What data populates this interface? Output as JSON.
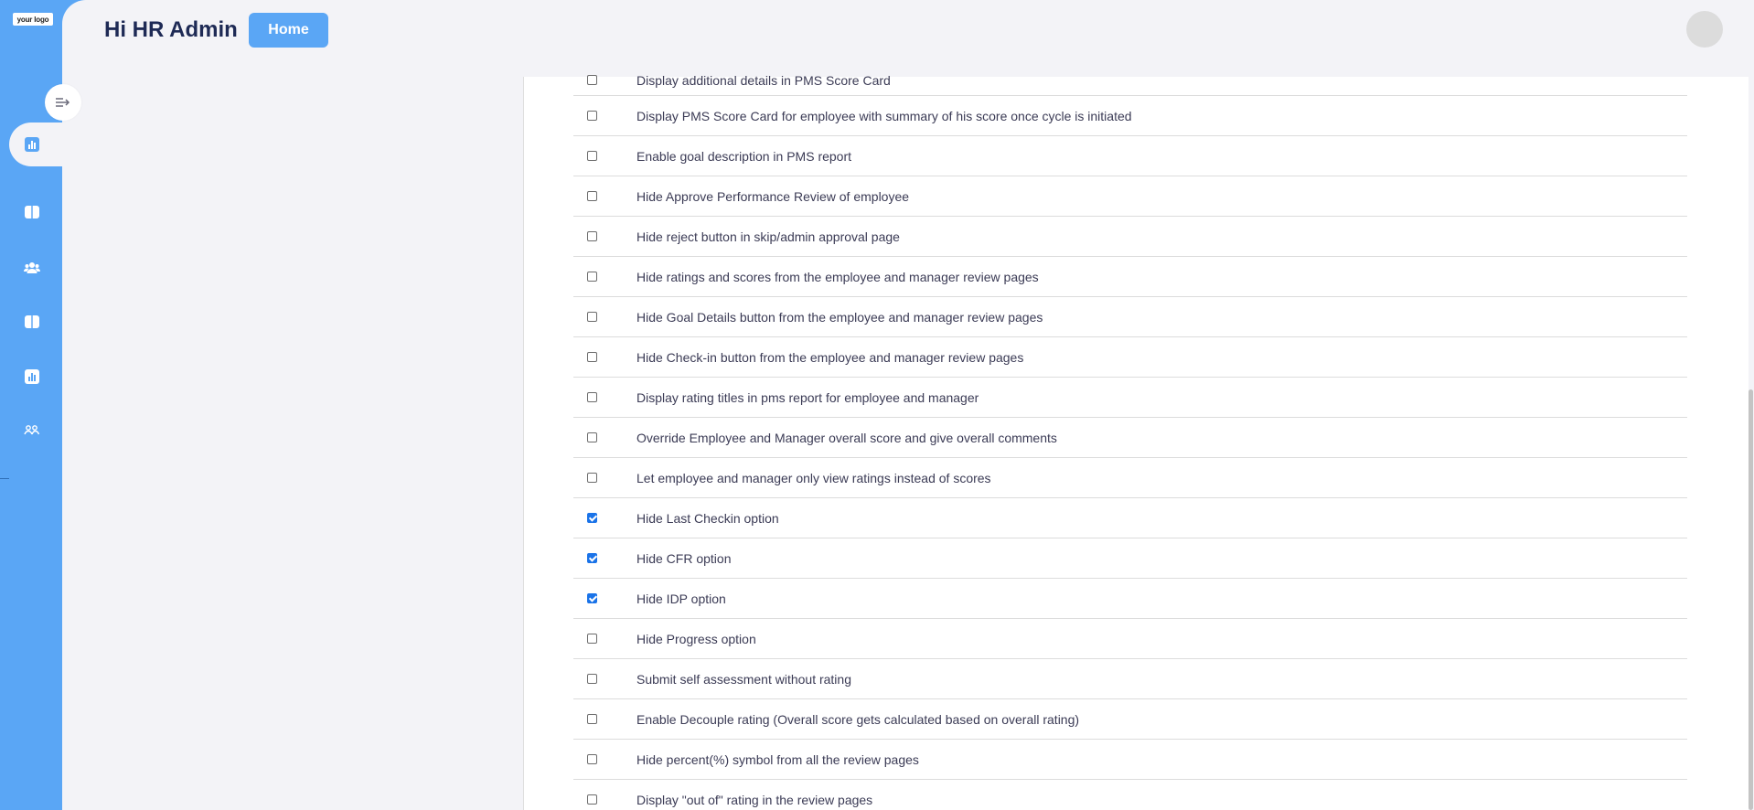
{
  "app": {
    "logo_text": "your logo",
    "greeting": "Hi HR Admin",
    "home_label": "Home",
    "accent_color": "#5aa6f5",
    "checkbox_checked_color": "#1a73e8"
  },
  "sidebar": {
    "items": [
      {
        "icon": "chart-icon",
        "active": true
      },
      {
        "icon": "book-icon",
        "active": false
      },
      {
        "icon": "users-icon",
        "active": false
      },
      {
        "icon": "book-icon",
        "active": false
      },
      {
        "icon": "chart-icon",
        "active": false
      },
      {
        "icon": "settings-people-icon",
        "active": false
      }
    ]
  },
  "settings": {
    "options": [
      {
        "label": "Display additional details in PMS Score Card",
        "checked": false
      },
      {
        "label": "Display PMS Score Card for employee with summary of his score once cycle is initiated",
        "checked": false
      },
      {
        "label": "Enable goal description in PMS report",
        "checked": false
      },
      {
        "label": "Hide Approve Performance Review of employee",
        "checked": false
      },
      {
        "label": "Hide reject button in skip/admin approval page",
        "checked": false
      },
      {
        "label": "Hide ratings and scores from the employee and manager review pages",
        "checked": false
      },
      {
        "label": "Hide Goal Details button from the employee and manager review pages",
        "checked": false
      },
      {
        "label": "Hide Check-in button from the employee and manager review pages",
        "checked": false
      },
      {
        "label": "Display rating titles in pms report for employee and manager",
        "checked": false
      },
      {
        "label": "Override Employee and Manager overall score and give overall comments",
        "checked": false
      },
      {
        "label": "Let employee and manager only view ratings instead of scores",
        "checked": false
      },
      {
        "label": "Hide Last Checkin option",
        "checked": true
      },
      {
        "label": "Hide CFR option",
        "checked": true
      },
      {
        "label": "Hide IDP option",
        "checked": true
      },
      {
        "label": "Hide Progress option",
        "checked": false
      },
      {
        "label": "Submit self assessment without rating",
        "checked": false
      },
      {
        "label": "Enable Decouple rating (Overall score gets calculated based on overall rating)",
        "checked": false
      },
      {
        "label": "Hide percent(%) symbol from all the review pages",
        "checked": false
      },
      {
        "label": "Display \"out of\" rating in the review pages",
        "checked": false
      }
    ]
  }
}
